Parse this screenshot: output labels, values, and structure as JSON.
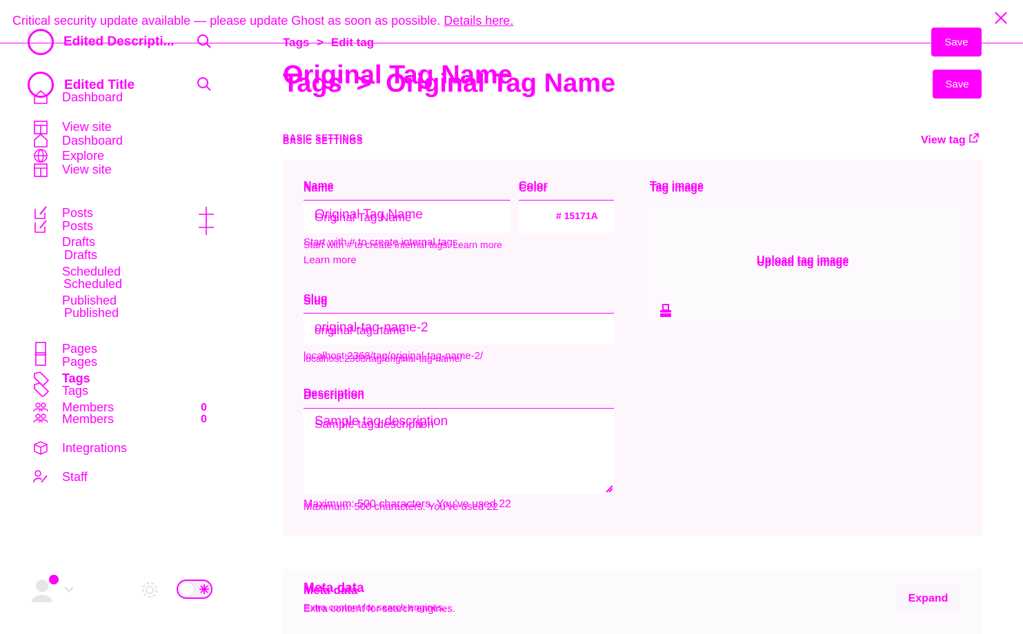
{
  "banner": {
    "message": "Critical security update available — please update Ghost as soon as possible.",
    "link": "Details here."
  },
  "sidebar": {
    "site_title_top": "Edited Descripti...",
    "site_title": "Edited Title",
    "nav": {
      "dashboard": "Dashboard",
      "view_site": "View site",
      "explore": "Explore",
      "posts": "Posts",
      "drafts": "Drafts",
      "scheduled": "Scheduled",
      "published": "Published",
      "pages": "Pages",
      "tags": "Tags",
      "members": "Members",
      "members_count": "0",
      "integrations": "Integrations",
      "staff": "Staff"
    }
  },
  "header": {
    "breadcrumb_parent": "Tags",
    "breadcrumb_current": "Edit tag",
    "breadcrumb_sep": ">",
    "title_overlay": "Original Tag Name",
    "title_parent": "Tags",
    "title_sep": ">",
    "title": "Original Tag Name",
    "save_label": "Save"
  },
  "basic_settings": {
    "heading": "BASIC SETTINGS",
    "view_tag": "View tag",
    "name_label": "Name",
    "name_value": "Original Tag Name",
    "name_hint": "Start with # to create internal tags.",
    "name_hint_link": "Learn more",
    "color_label": "Color",
    "color_value": "15171A",
    "color_prefix": "#",
    "slug_label": "Slug",
    "slug_value": "original-tag-name-2",
    "slug_overlay": "original-tag-name",
    "url_preview": "localhost:2368/tag/original-tag-name-2/",
    "url_overlay": "localhost:2368/tag/original-tag-name/",
    "description_label": "Description",
    "description_value": "Sample tag description",
    "description_hint": "Maximum: 500 characters. You've used 22",
    "image_label": "Tag image",
    "upload_label": "Upload tag image"
  },
  "meta": {
    "heading": "Meta data",
    "subtitle": "Extra content for search engines.",
    "expand_label": "Expand"
  },
  "icons": {
    "close": "close-icon",
    "search": "search-icon",
    "home": "home-icon",
    "globe": "globe-icon",
    "edit": "edit-icon",
    "plus": "plus-icon",
    "page": "page-icon",
    "tag": "tag-icon",
    "members": "members-icon",
    "integrations": "cube-icon",
    "staff": "staff-icon",
    "external": "external-link-icon",
    "image": "image-icon",
    "settings": "gear-icon",
    "avatar": "avatar-icon",
    "moon": "moon-icon"
  },
  "colors": {
    "accent": "#ff00ff",
    "background": "#ffffff"
  }
}
